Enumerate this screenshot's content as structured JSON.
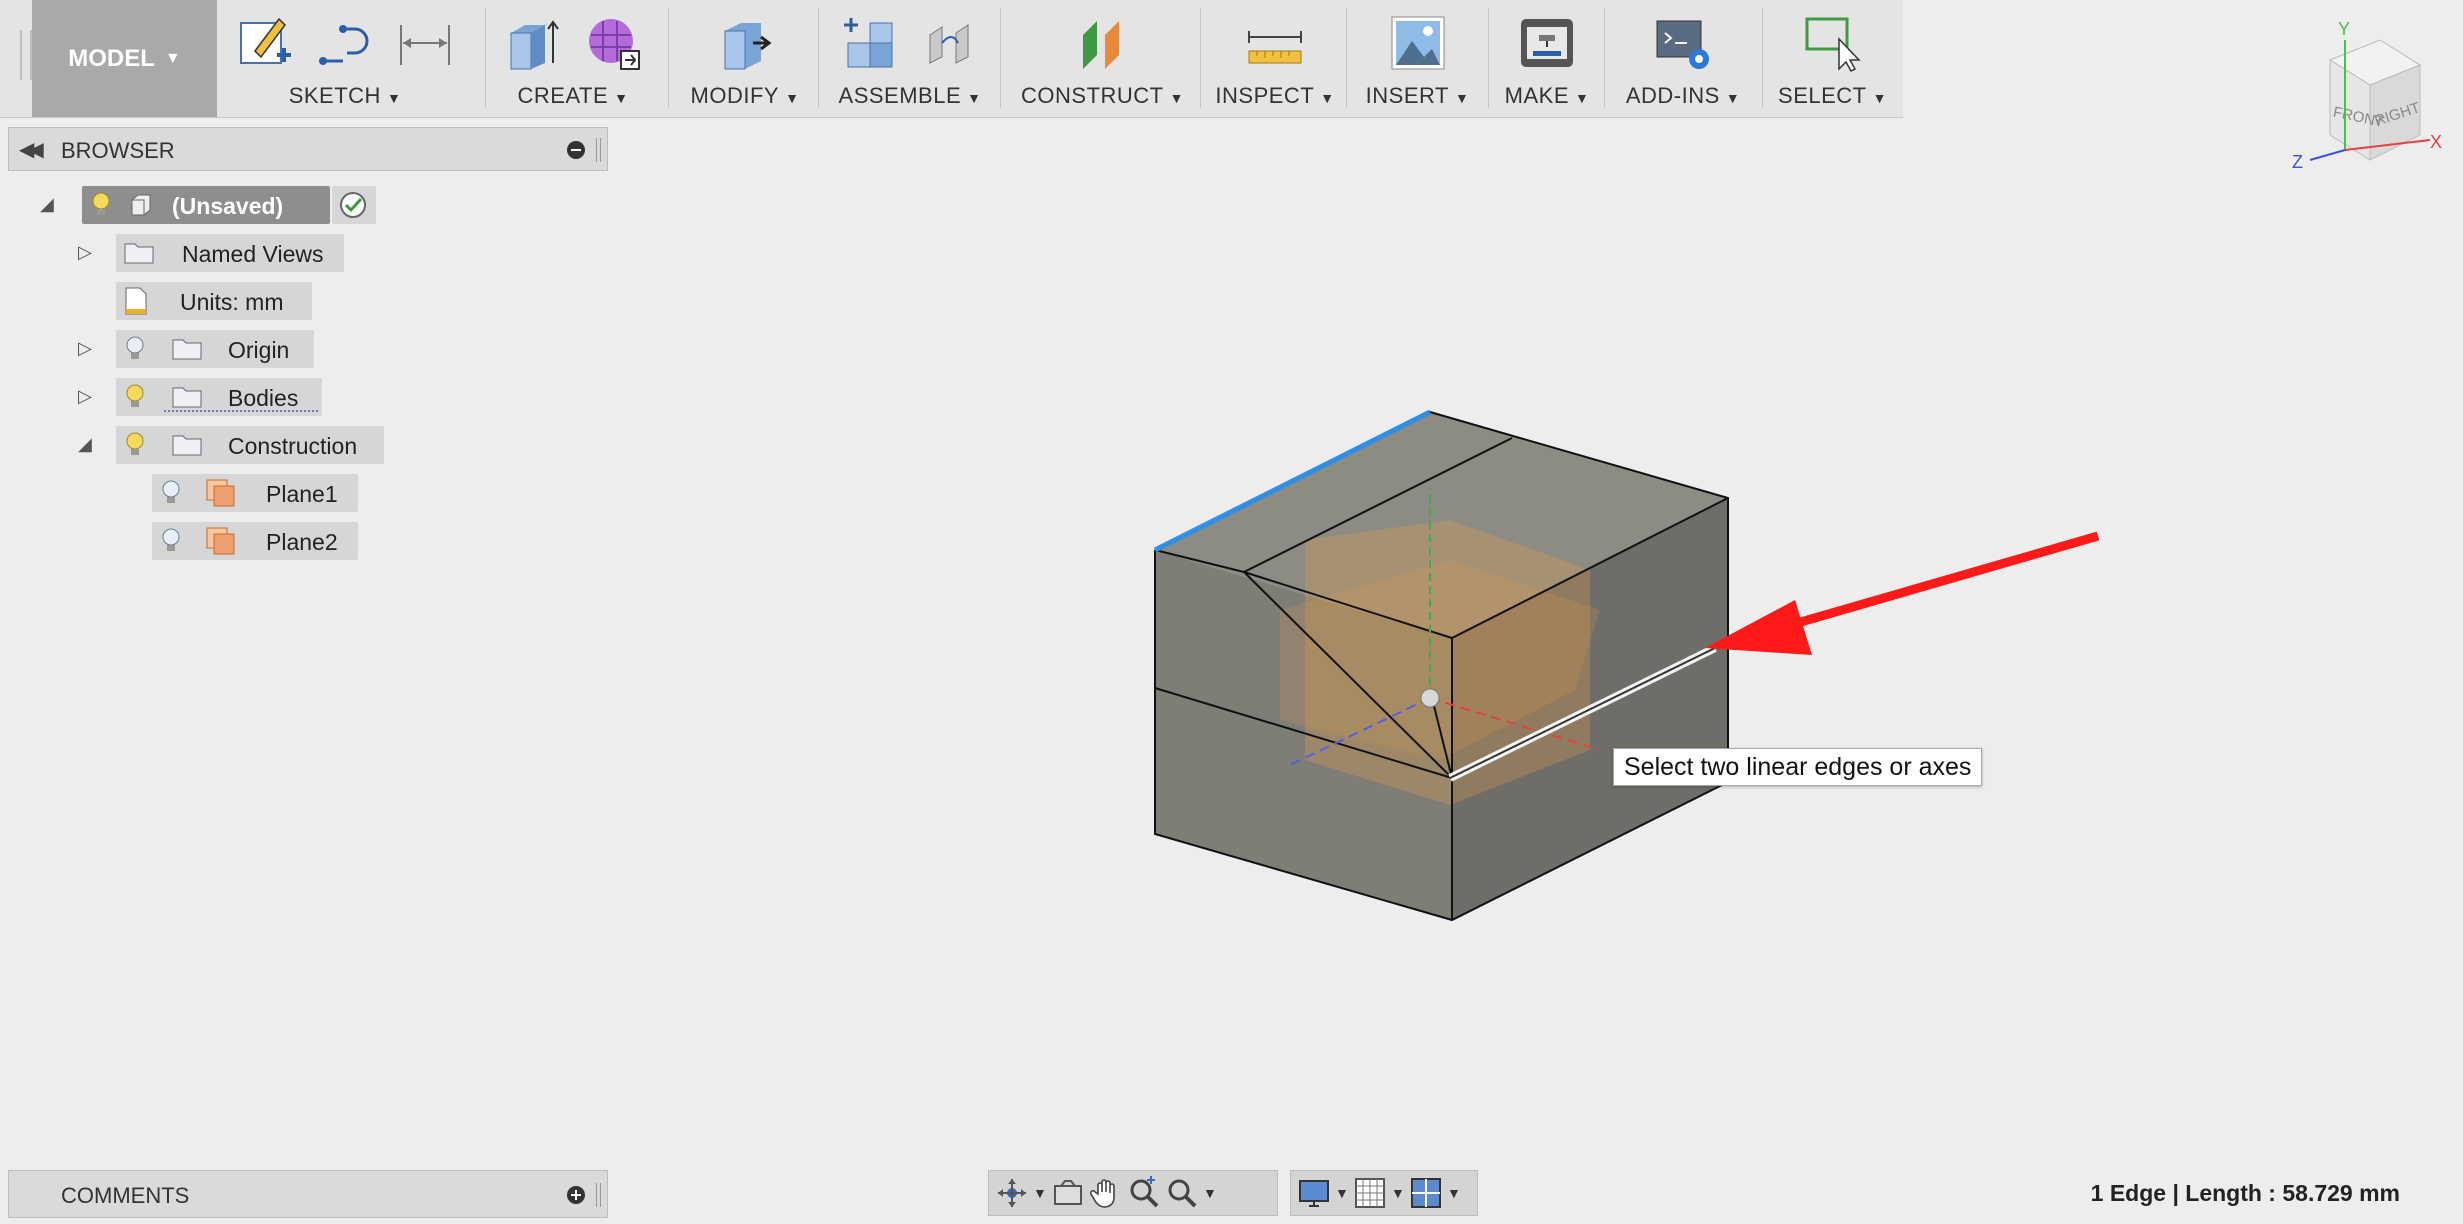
{
  "toolbar": {
    "workspace": "MODEL",
    "groups": [
      {
        "id": "sketch",
        "label": "SKETCH"
      },
      {
        "id": "create",
        "label": "CREATE"
      },
      {
        "id": "modify",
        "label": "MODIFY"
      },
      {
        "id": "assemble",
        "label": "ASSEMBLE"
      },
      {
        "id": "construct",
        "label": "CONSTRUCT"
      },
      {
        "id": "inspect",
        "label": "INSPECT"
      },
      {
        "id": "insert",
        "label": "INSERT"
      },
      {
        "id": "make",
        "label": "MAKE"
      },
      {
        "id": "addins",
        "label": "ADD-INS"
      },
      {
        "id": "select",
        "label": "SELECT"
      }
    ]
  },
  "browser": {
    "title": "BROWSER",
    "root": "(Unsaved)",
    "items": [
      {
        "label": "Named Views"
      },
      {
        "label": "Units: mm"
      },
      {
        "label": "Origin"
      },
      {
        "label": "Bodies"
      },
      {
        "label": "Construction"
      },
      {
        "label": "Plane1"
      },
      {
        "label": "Plane2"
      }
    ]
  },
  "canvas": {
    "tooltip": "Select two linear edges or axes",
    "viewcube": {
      "front": "FRONT",
      "right": "RIGHT",
      "x": "X",
      "y": "Y",
      "z": "Z"
    }
  },
  "comments": {
    "title": "COMMENTS"
  },
  "status": {
    "text": "1 Edge | Length : 58.729 mm"
  },
  "colors": {
    "accent_red": "#ff1a1a",
    "selection_blue": "#2f8fe6",
    "plane_orange": "#e8a048",
    "body_gray": "#8a8a82"
  }
}
